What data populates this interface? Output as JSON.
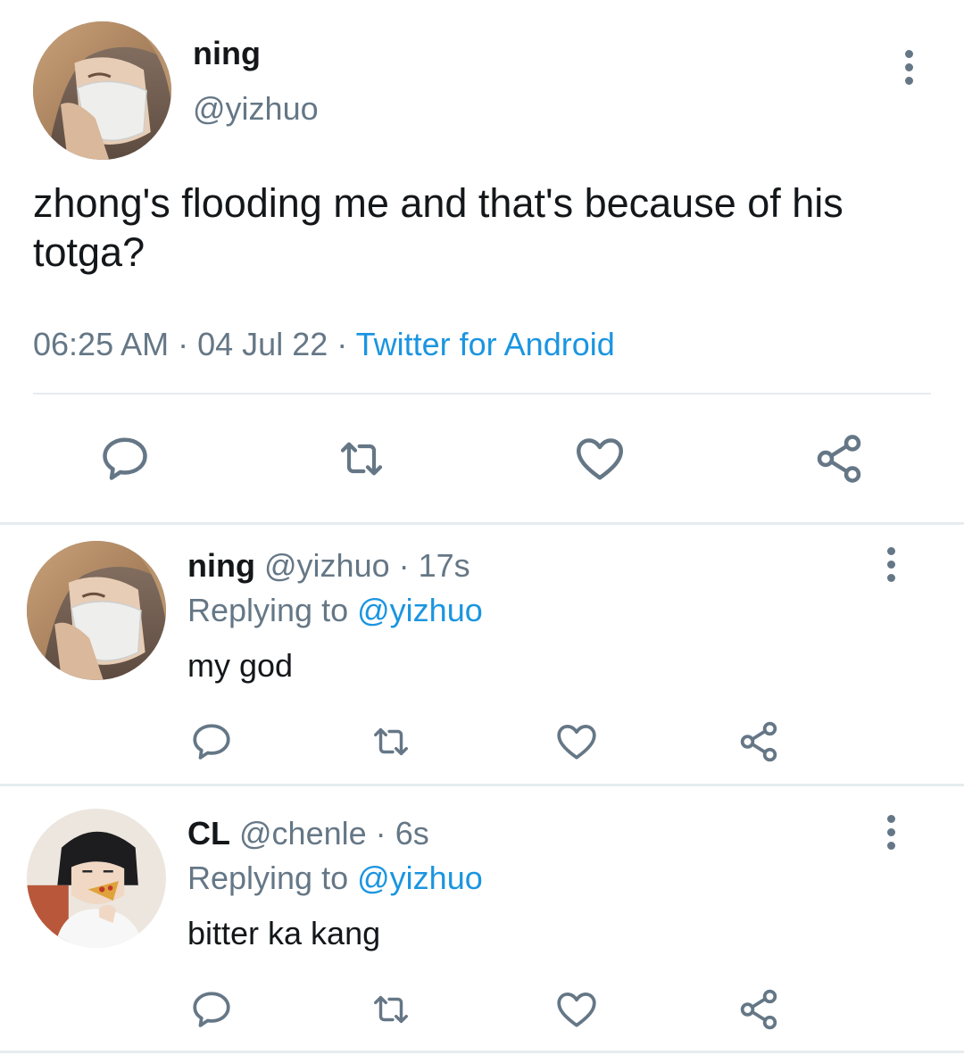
{
  "main_tweet": {
    "name": "ning",
    "handle": "@yizhuo",
    "text": "zhong's flooding me and that's because of his totga?",
    "time": "06:25 AM",
    "date": "04 Jul 22",
    "separator": "·",
    "source": "Twitter for Android",
    "avatar": "masked-woman-avatar",
    "actions": [
      "reply-icon",
      "retweet-icon",
      "like-icon",
      "share-icon"
    ]
  },
  "replies": [
    {
      "name": "ning",
      "handle": "@yizhuo",
      "time_sep": "·",
      "time": "17s",
      "replying_label": "Replying to",
      "replying_to": "@yizhuo",
      "text": "my god",
      "avatar": "masked-woman-avatar"
    },
    {
      "name": "CL",
      "handle": "@chenle",
      "time_sep": "·",
      "time": "6s",
      "replying_label": "Replying to",
      "replying_to": "@yizhuo",
      "text": "bitter ka kang",
      "avatar": "boy-eating-pizza-avatar"
    }
  ],
  "colors": {
    "text": "#14171a",
    "secondary": "#657786",
    "link": "#1b95e0",
    "divider": "#e6ecf0"
  }
}
